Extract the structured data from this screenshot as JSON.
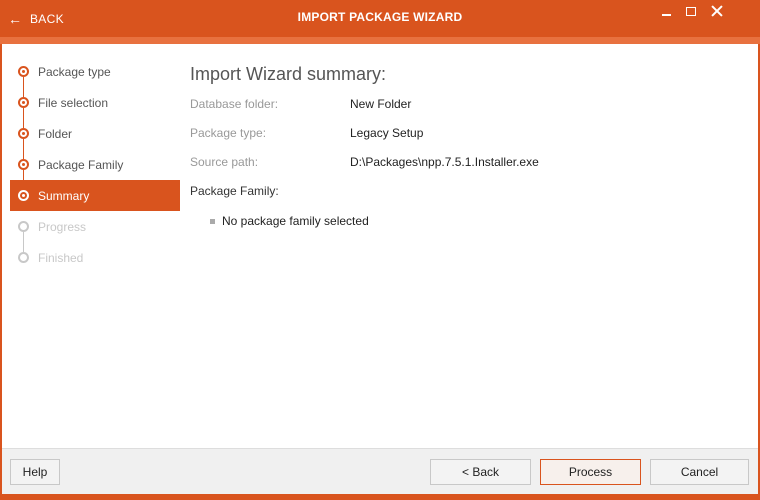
{
  "titlebar": {
    "back_label": "BACK",
    "title": "IMPORT PACKAGE WIZARD"
  },
  "sidebar": {
    "steps": [
      {
        "label": "Package type",
        "state": "done"
      },
      {
        "label": "File selection",
        "state": "done"
      },
      {
        "label": "Folder",
        "state": "done"
      },
      {
        "label": "Package Family",
        "state": "done"
      },
      {
        "label": "Summary",
        "state": "active"
      },
      {
        "label": "Progress",
        "state": "disabled"
      },
      {
        "label": "Finished",
        "state": "disabled"
      }
    ]
  },
  "main": {
    "heading": "Import Wizard summary:",
    "fields": [
      {
        "key": "Database folder:",
        "value": "New Folder"
      },
      {
        "key": "Package type:",
        "value": "Legacy Setup"
      },
      {
        "key": "Source path:",
        "value": "D:\\Packages\\npp.7.5.1.Installer.exe"
      }
    ],
    "package_family_label": "Package Family:",
    "package_family_items": [
      "No package family selected"
    ]
  },
  "footer": {
    "help_label": "Help",
    "back_label": "< Back",
    "process_label": "Process",
    "cancel_label": "Cancel"
  },
  "colors": {
    "accent": "#d9541e",
    "disabled": "#c8c8c8"
  }
}
